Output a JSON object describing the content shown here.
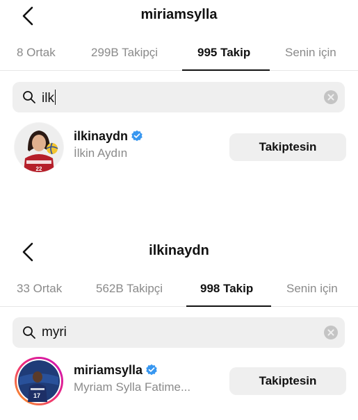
{
  "panels": [
    {
      "header_title": "miriamsylla",
      "tabs": [
        {
          "label": "8 Ortak"
        },
        {
          "label": "299B Takipçi"
        },
        {
          "label": "995 Takip"
        },
        {
          "label": "Senin için"
        }
      ],
      "active_tab": "995 Takip",
      "search_query": "ilk",
      "result": {
        "username": "ilkinaydn",
        "full_name": "İlkin Aydın",
        "verified": true,
        "button_label": "Takiptesin"
      }
    },
    {
      "header_title": "ilkinaydn",
      "tabs": [
        {
          "label": "33 Ortak"
        },
        {
          "label": "562B Takipçi"
        },
        {
          "label": "998 Takip"
        },
        {
          "label": "Senin için"
        }
      ],
      "active_tab": "998 Takip",
      "search_query": "myri",
      "result": {
        "username": "miriamsylla",
        "full_name": "Myriam Sylla Fatime...",
        "verified": true,
        "button_label": "Takiptesin"
      }
    }
  ],
  "colors": {
    "verified_badge": "#3897f0",
    "story_ring_start": "#f9a51a",
    "story_ring_end": "#c913b9"
  },
  "icons": [
    "back-chevron-icon",
    "search-icon",
    "clear-icon",
    "verified-badge-icon"
  ]
}
